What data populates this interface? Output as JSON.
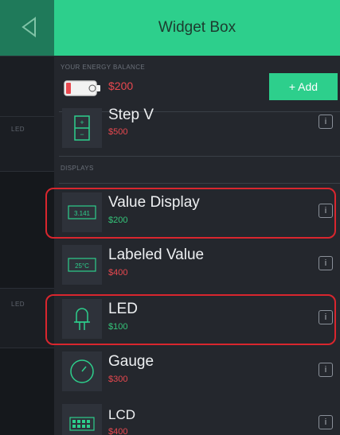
{
  "header": {
    "title": "Widget Box"
  },
  "energy": {
    "section_label": "YOUR ENERGY BALANCE",
    "amount": "$200",
    "add_label": "+ Add"
  },
  "left": {
    "labels": [
      "LED",
      "LED"
    ]
  },
  "widgets": [
    {
      "name": "Step V",
      "price": "$500",
      "price_color": "#e8484f",
      "icon": "step-icon"
    }
  ],
  "displays": {
    "section_label": "DISPLAYS",
    "items": [
      {
        "name": "Value Display",
        "price": "$200",
        "price_color": "#35c57a",
        "icon": "value-display-icon",
        "icon_text": "3.141"
      },
      {
        "name": "Labeled Value",
        "price": "$400",
        "price_color": "#e8484f",
        "icon": "labeled-value-icon",
        "icon_text": "25°C"
      },
      {
        "name": "LED",
        "price": "$100",
        "price_color": "#35c57a",
        "icon": "led-icon"
      },
      {
        "name": "Gauge",
        "price": "$300",
        "price_color": "#e8484f",
        "icon": "gauge-icon"
      },
      {
        "name": "LCD",
        "price": "$400",
        "price_color": "#e8484f",
        "icon": "lcd-icon"
      }
    ]
  },
  "info_label": "i",
  "colors": {
    "accent": "#2dcf8c",
    "highlight": "#d9262e",
    "price_green": "#35c57a",
    "price_red": "#e8484f"
  }
}
